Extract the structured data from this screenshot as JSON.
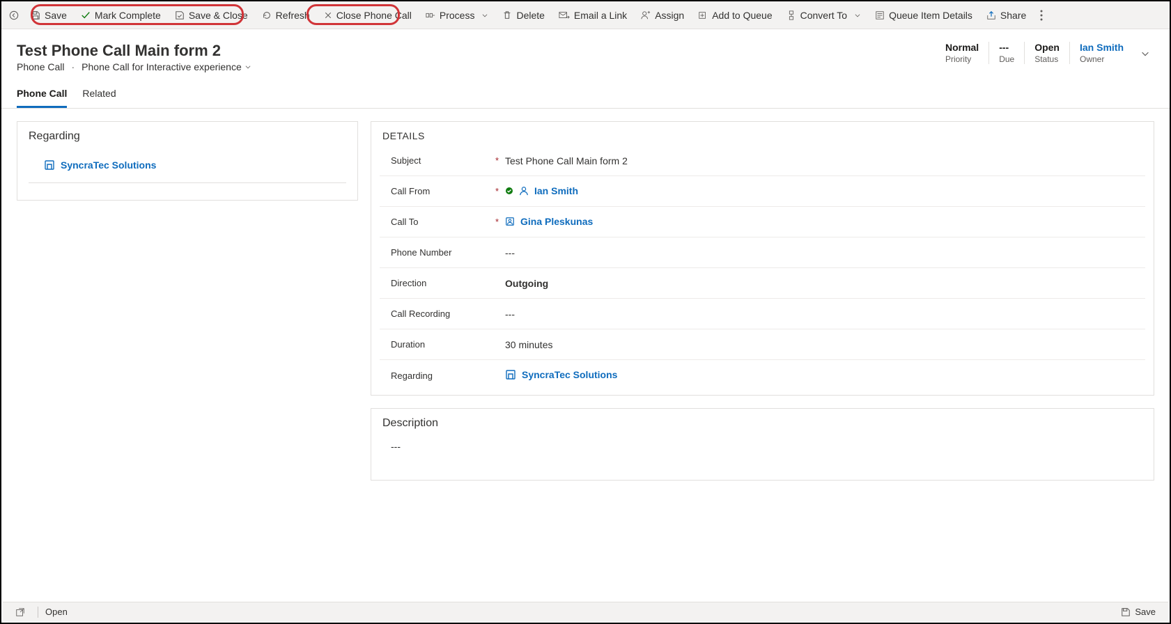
{
  "toolbar": {
    "save": "Save",
    "mark_complete": "Mark Complete",
    "save_close": "Save & Close",
    "refresh": "Refresh",
    "close_phone_call": "Close Phone Call",
    "process": "Process",
    "delete": "Delete",
    "email_link": "Email a Link",
    "assign": "Assign",
    "add_queue": "Add to Queue",
    "convert_to": "Convert To",
    "queue_item_details": "Queue Item Details",
    "share": "Share"
  },
  "header": {
    "title": "Test Phone Call Main form 2",
    "entity": "Phone Call",
    "form_name": "Phone Call for Interactive experience",
    "summary": {
      "priority": {
        "value": "Normal",
        "label": "Priority"
      },
      "due": {
        "value": "---",
        "label": "Due"
      },
      "status": {
        "value": "Open",
        "label": "Status"
      },
      "owner": {
        "value": "Ian Smith",
        "label": "Owner"
      }
    }
  },
  "tabs": [
    "Phone Call",
    "Related"
  ],
  "regarding": {
    "title": "Regarding",
    "item": "SyncraTec Solutions"
  },
  "details": {
    "title": "DETAILS",
    "rows": {
      "subject": {
        "label": "Subject",
        "required": true,
        "value": "Test Phone Call Main form 2"
      },
      "call_from": {
        "label": "Call From",
        "required": true,
        "value": "Ian Smith"
      },
      "call_to": {
        "label": "Call To",
        "required": true,
        "value": "Gina Pleskunas"
      },
      "phone_number": {
        "label": "Phone Number",
        "required": false,
        "value": "---"
      },
      "direction": {
        "label": "Direction",
        "required": false,
        "value": "Outgoing"
      },
      "call_recording": {
        "label": "Call Recording",
        "required": false,
        "value": "---"
      },
      "duration": {
        "label": "Duration",
        "required": false,
        "value": "30 minutes"
      },
      "regarding": {
        "label": "Regarding",
        "required": false,
        "value": "SyncraTec Solutions"
      }
    }
  },
  "description": {
    "title": "Description",
    "value": "---"
  },
  "statusbar": {
    "status": "Open",
    "save": "Save"
  }
}
